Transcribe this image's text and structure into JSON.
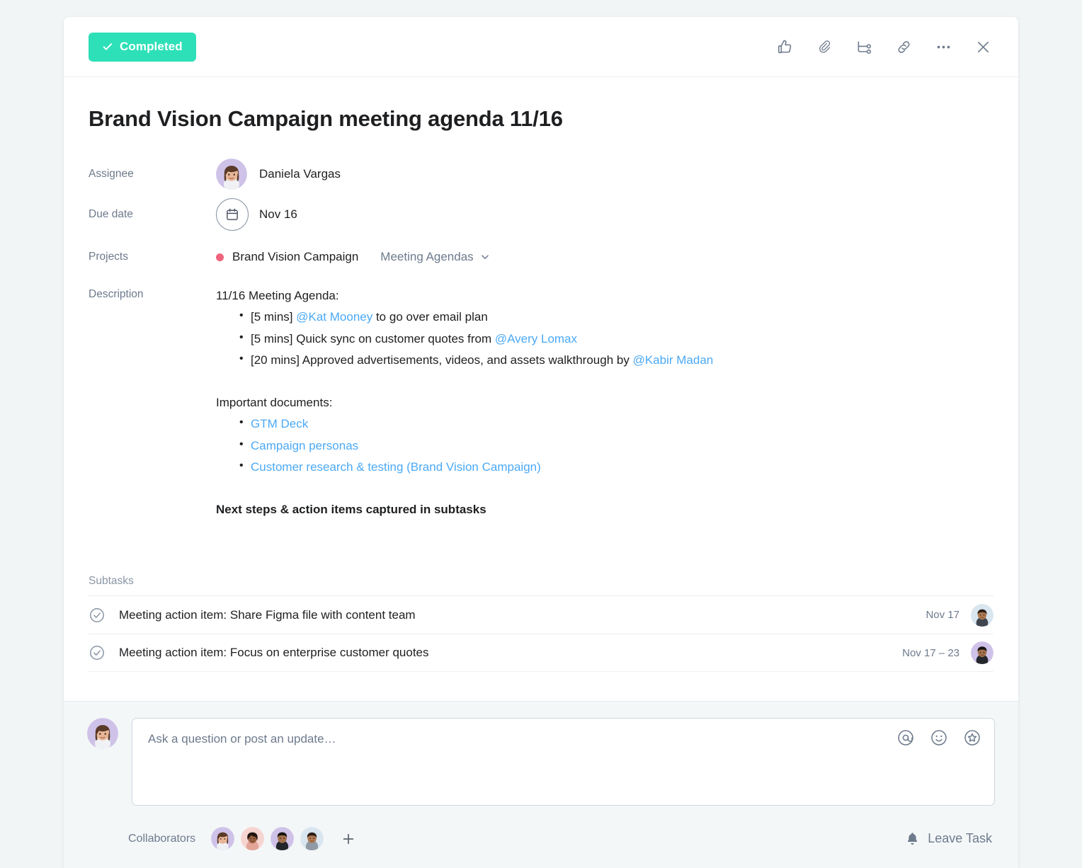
{
  "header": {
    "status_label": "Completed",
    "status_color": "#2ee0b8",
    "icons": [
      {
        "name": "thumbs-up-icon",
        "label": "Like"
      },
      {
        "name": "paperclip-icon",
        "label": "Attach file"
      },
      {
        "name": "subtask-icon",
        "label": "Add subtask"
      },
      {
        "name": "link-icon",
        "label": "Copy task link"
      },
      {
        "name": "more-options-icon",
        "label": "More options"
      },
      {
        "name": "close-icon",
        "label": "Close"
      }
    ]
  },
  "task": {
    "title": "Brand Vision Campaign meeting agenda 11/16",
    "assignee_label": "Assignee",
    "assignee_name": "Daniela Vargas",
    "due_date_label": "Due date",
    "due_date": "Nov 16",
    "projects_label": "Projects",
    "project_name": "Brand Vision Campaign",
    "project_dot_color": "#f0637c",
    "project_section": "Meeting Agendas",
    "description_label": "Description"
  },
  "description": {
    "heading": "11/16 Meeting Agenda:",
    "agenda_items": [
      {
        "prefix": "[5 mins] ",
        "mention": "@Kat Mooney",
        "suffix": " to go over email plan"
      },
      {
        "prefix": "[5 mins] Quick sync on customer quotes from ",
        "mention": "@Avery Lomax",
        "suffix": ""
      },
      {
        "prefix": "[20 mins] Approved advertisements, videos, and assets walkthrough by ",
        "mention": "@Kabir Madan",
        "suffix": ""
      }
    ],
    "documents_heading": "Important documents:",
    "documents": [
      "GTM Deck",
      "Campaign personas",
      "Customer research & testing (Brand Vision Campaign)"
    ],
    "closing_note": "Next steps & action items captured in subtasks",
    "link_color": "#4ba9f5"
  },
  "subtasks": {
    "header": "Subtasks",
    "items": [
      {
        "name": "Meeting action item: Share Figma file with content team",
        "date": "Nov 17",
        "avatar_bg": "#d9e6ef",
        "skin": "#b07a52",
        "hair": "#2c2019"
      },
      {
        "name": "Meeting action item: Focus on enterprise customer quotes",
        "date": "Nov 17 – 23",
        "avatar_bg": "#cfc2e8",
        "skin": "#a3714c",
        "hair": "#171311"
      }
    ]
  },
  "comment": {
    "placeholder": "Ask a question or post an update…",
    "value": "",
    "icons": [
      {
        "name": "mention-icon",
        "label": "Mention someone"
      },
      {
        "name": "emoji-icon",
        "label": "Insert emoji"
      },
      {
        "name": "sticker-icon",
        "label": "Insert sticker"
      }
    ]
  },
  "footer": {
    "collaborators_label": "Collaborators",
    "collaborators": [
      {
        "bg": "#cfc2e8",
        "skin": "#e8b596",
        "hair": "#5a3a28"
      },
      {
        "bg": "#f6d4d0",
        "skin": "#9a6242",
        "hair": "#20160f"
      },
      {
        "bg": "#cfc2e8",
        "skin": "#a3714c",
        "hair": "#171311"
      },
      {
        "bg": "#d9e6ef",
        "skin": "#b07a52",
        "hair": "#2c2019"
      }
    ],
    "add_collaborator_label": "+",
    "leave_task_label": "Leave Task"
  }
}
